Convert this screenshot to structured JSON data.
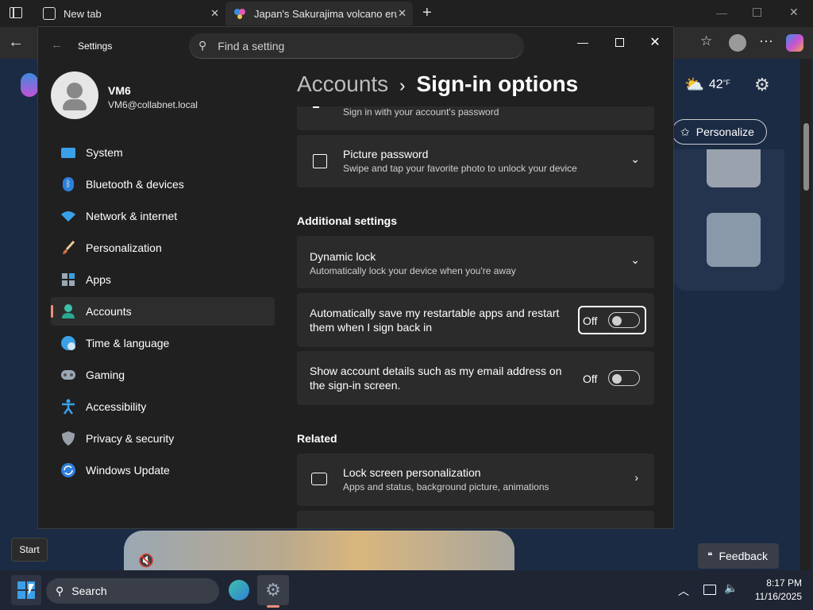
{
  "browser": {
    "tab1_title": "New tab",
    "tab2_title": "Japan's Sakurajima volcano erupt",
    "weather_temp": "42",
    "weather_unit": "°F",
    "personalize_label": "Personalize",
    "feedback_label": "Feedback"
  },
  "settings": {
    "app_title": "Settings",
    "search_placeholder": "Find a setting",
    "user": {
      "name": "VM6",
      "email": "VM6@collabnet.local"
    },
    "breadcrumb": {
      "parent": "Accounts",
      "separator": "›",
      "current": "Sign-in options"
    },
    "nav": [
      {
        "label": "System",
        "icon": "system-icon"
      },
      {
        "label": "Bluetooth & devices",
        "icon": "bluetooth-icon"
      },
      {
        "label": "Network & internet",
        "icon": "wifi-icon"
      },
      {
        "label": "Personalization",
        "icon": "brush-icon"
      },
      {
        "label": "Apps",
        "icon": "apps-icon"
      },
      {
        "label": "Accounts",
        "icon": "accounts-icon"
      },
      {
        "label": "Time & language",
        "icon": "globe-icon"
      },
      {
        "label": "Gaming",
        "icon": "gamepad-icon"
      },
      {
        "label": "Accessibility",
        "icon": "accessibility-icon"
      },
      {
        "label": "Privacy & security",
        "icon": "shield-icon"
      },
      {
        "label": "Windows Update",
        "icon": "update-icon"
      }
    ],
    "active_nav": "Accounts",
    "partial_card_sub": "Sign in with your account's password",
    "picture_password": {
      "title": "Picture password",
      "sub": "Swipe and tap your favorite photo to unlock your device"
    },
    "additional_heading": "Additional settings",
    "dynamic_lock": {
      "title": "Dynamic lock",
      "sub": "Automatically lock your device when you're away"
    },
    "restart_apps": {
      "text": "Automatically save my restartable apps and restart them when I sign back in",
      "state": "Off"
    },
    "account_details": {
      "text": "Show account details such as my email address on the sign-in screen.",
      "state": "Off"
    },
    "related_heading": "Related",
    "lock_screen": {
      "title": "Lock screen personalization",
      "sub": "Apps and status, background picture, animations"
    }
  },
  "taskbar": {
    "start_tooltip": "Start",
    "search_label": "Search",
    "time": "8:17 PM",
    "date": "11/16/2025"
  }
}
